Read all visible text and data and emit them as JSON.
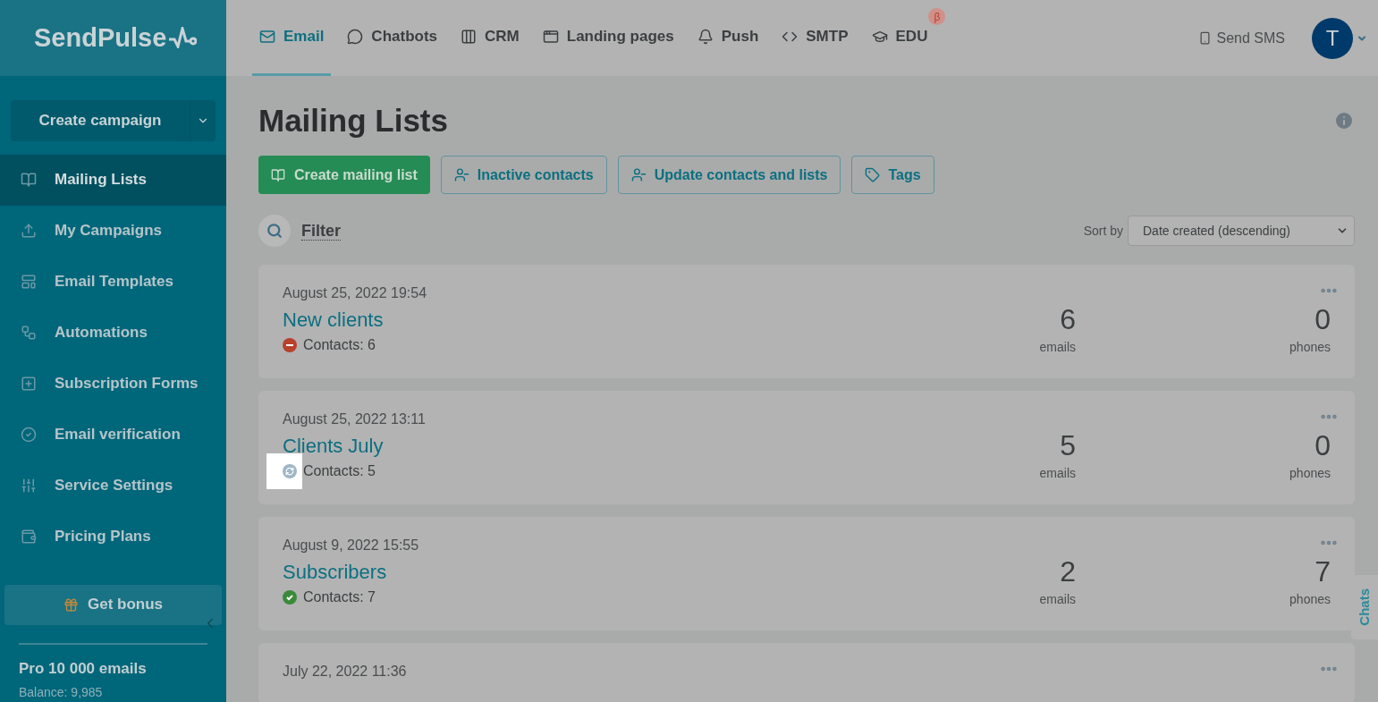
{
  "logo": {
    "text": "SendPulse"
  },
  "sidebar": {
    "create_button": "Create campaign",
    "items": [
      {
        "label": "Mailing Lists",
        "selected": true
      },
      {
        "label": "My Campaigns",
        "selected": false
      },
      {
        "label": "Email Templates",
        "selected": false
      },
      {
        "label": "Automations",
        "selected": false
      },
      {
        "label": "Subscription Forms",
        "selected": false
      },
      {
        "label": "Email verification",
        "selected": false
      },
      {
        "label": "Service Settings",
        "selected": false
      },
      {
        "label": "Pricing Plans",
        "selected": false
      }
    ],
    "bonus_button": "Get bonus",
    "plan": "Pro 10 000 emails",
    "balance": "Balance: 9,985"
  },
  "top_nav": {
    "tabs": [
      {
        "label": "Email",
        "selected": true
      },
      {
        "label": "Chatbots",
        "selected": false
      },
      {
        "label": "CRM",
        "selected": false
      },
      {
        "label": "Landing pages",
        "selected": false
      },
      {
        "label": "Push",
        "selected": false
      },
      {
        "label": "SMTP",
        "selected": false
      },
      {
        "label": "EDU",
        "selected": false,
        "badge": "β"
      }
    ],
    "send_sms": "Send SMS",
    "avatar": "T"
  },
  "page": {
    "title": "Mailing Lists",
    "buttons": [
      {
        "label": "Create mailing list",
        "kind": "primary"
      },
      {
        "label": "Inactive contacts",
        "kind": "outline"
      },
      {
        "label": "Update contacts and lists",
        "kind": "outline"
      },
      {
        "label": "Tags",
        "kind": "outline"
      }
    ],
    "filter": "Filter",
    "sort_label": "Sort by",
    "sort_value": "Date created (descending)"
  },
  "lists": [
    {
      "date": "August 25, 2022 19:54",
      "name": "New clients",
      "kind": "stopped",
      "contacts": "Contacts: 6",
      "emails": "6",
      "emails_label": "emails",
      "phones": "0",
      "phones_label": "phones",
      "highlighted": false
    },
    {
      "date": "August 25, 2022 13:11",
      "name": "Clients July",
      "kind": "pending",
      "contacts": "Contacts: 5",
      "emails": "5",
      "emails_label": "emails",
      "phones": "0",
      "phones_label": "phones",
      "highlighted": true
    },
    {
      "date": "August 9, 2022 15:55",
      "name": "Subscribers",
      "kind": "active",
      "contacts": "Contacts: 7",
      "emails": "2",
      "emails_label": "emails",
      "phones": "7",
      "phones_label": "phones",
      "highlighted": false
    },
    {
      "date": "July 22, 2022 11:36"
    }
  ],
  "chats_tab": "Chats"
}
